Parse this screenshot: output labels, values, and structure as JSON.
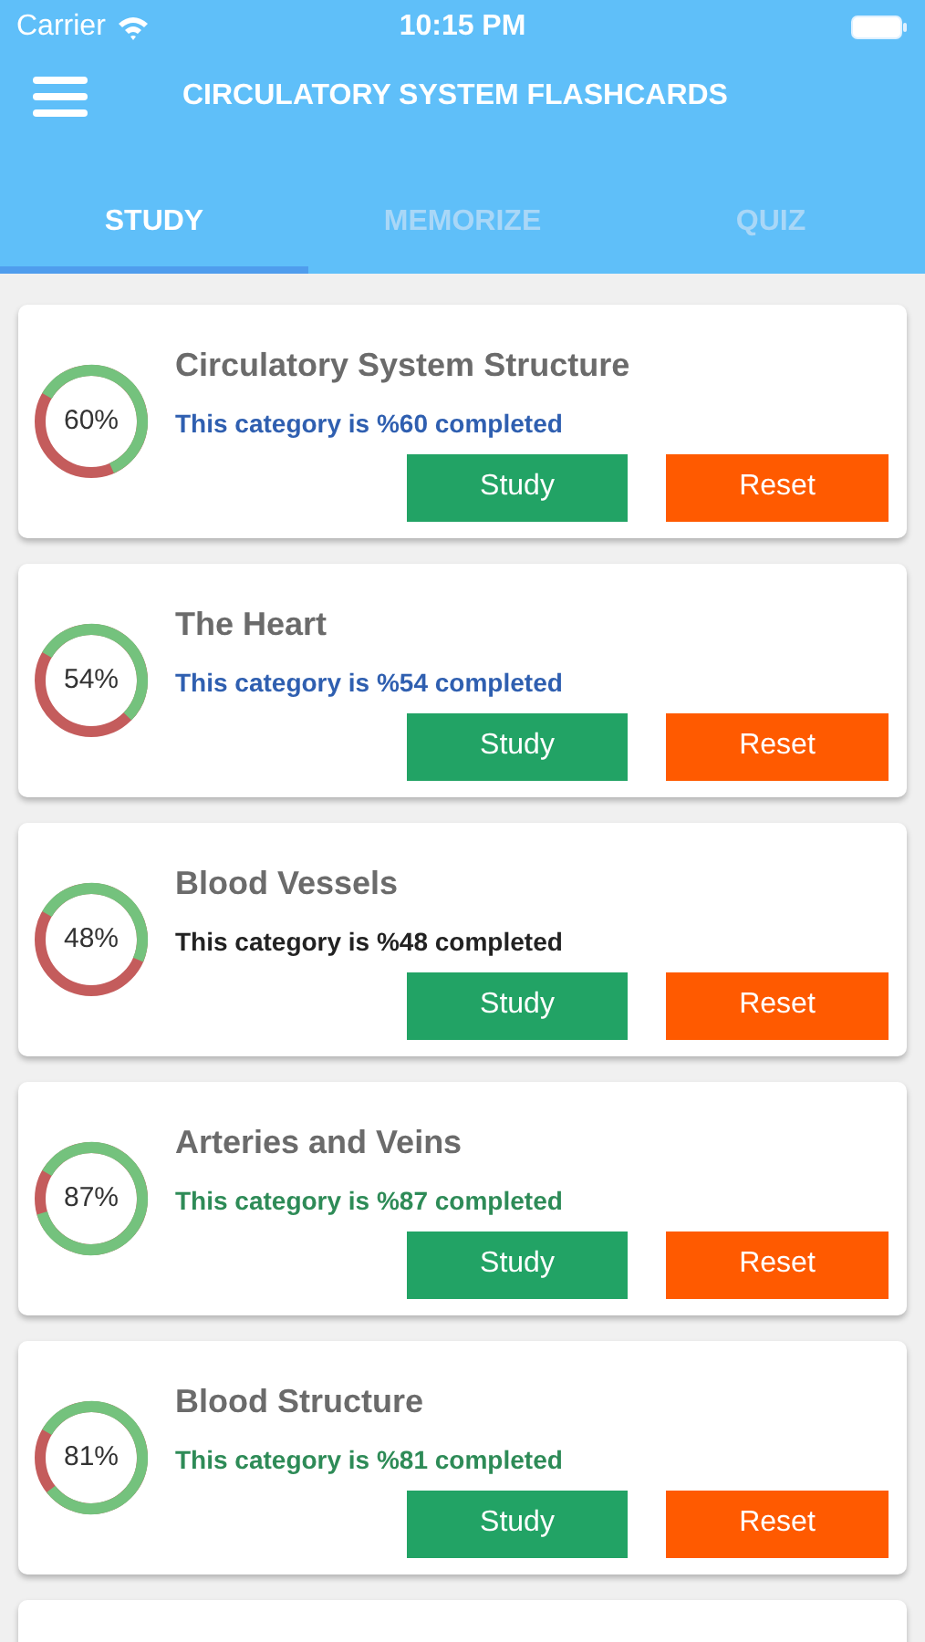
{
  "status_bar": {
    "carrier": "Carrier",
    "time": "10:15 PM"
  },
  "header": {
    "title": "CIRCULATORY SYSTEM FLASHCARDS"
  },
  "tabs": [
    {
      "label": "STUDY",
      "selected": true
    },
    {
      "label": "MEMORIZE",
      "selected": false
    },
    {
      "label": "QUIZ",
      "selected": false
    }
  ],
  "categories": [
    {
      "title": "Circulatory System Structure",
      "percent": "60%",
      "level": 0.6,
      "status": "This category is %60 completed",
      "color": "#2f5fb0",
      "study": "Study",
      "reset": "Reset"
    },
    {
      "title": "The Heart",
      "percent": "54%",
      "level": 0.54,
      "status": "This category is %54 completed",
      "color": "#2f5fb0",
      "study": "Study",
      "reset": "Reset"
    },
    {
      "title": "Blood Vessels",
      "percent": "48%",
      "level": 0.48,
      "status": "This category is %48 completed",
      "color": "#222222",
      "study": "Study",
      "reset": "Reset"
    },
    {
      "title": "Arteries and Veins",
      "percent": "87%",
      "level": 0.87,
      "status": "This category is %87 completed",
      "color": "#2e8b57",
      "study": "Study",
      "reset": "Reset"
    },
    {
      "title": "Blood Structure",
      "percent": "81%",
      "level": 0.81,
      "status": "This category is %81 completed",
      "color": "#2e8b57",
      "study": "Study",
      "reset": "Reset"
    }
  ]
}
